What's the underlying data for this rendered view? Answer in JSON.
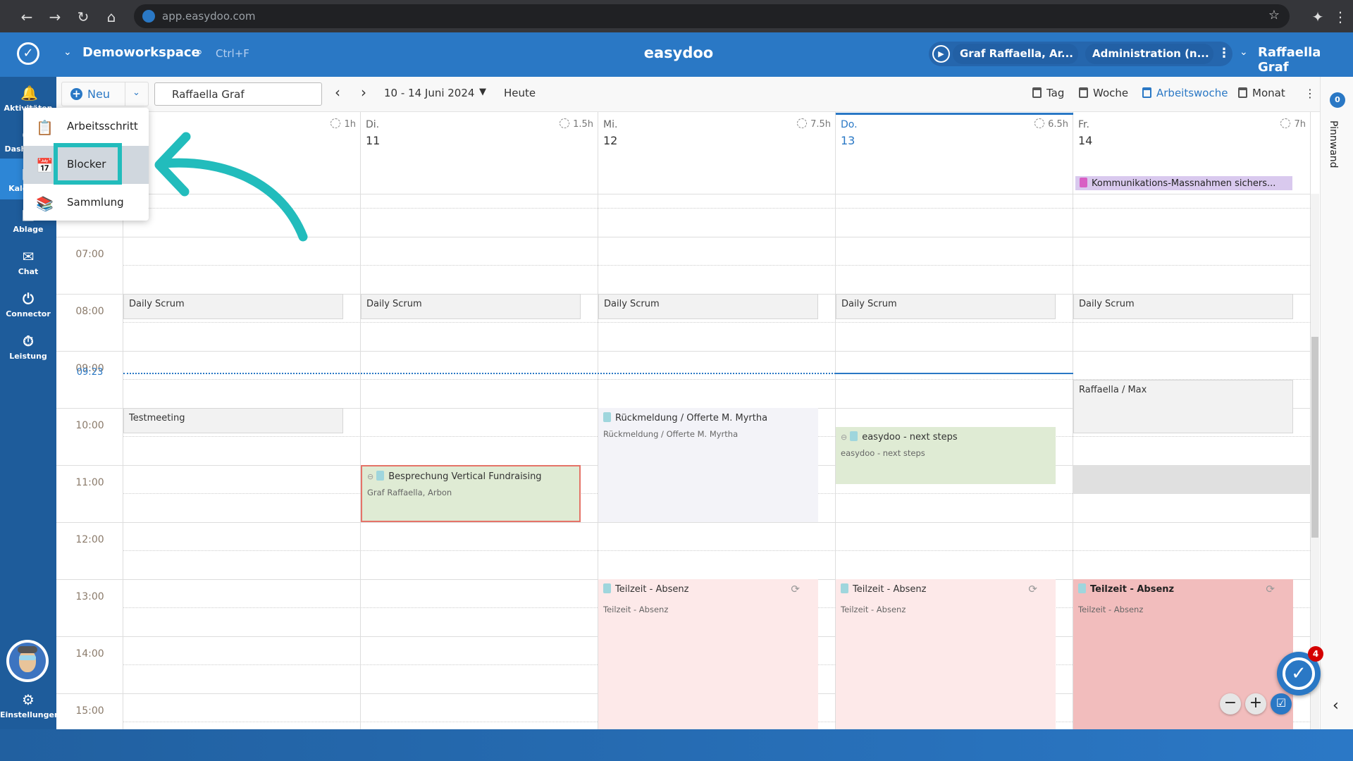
{
  "browser": {
    "url": "app.easydoo.com"
  },
  "header": {
    "workspace": "Demoworkspace",
    "search_hint": "Ctrl+F",
    "app_title": "easydoo",
    "timer_task": "Graf Raffaella, Ar...",
    "timer_activity": "Administration (n...",
    "user": "Raffaella Graf"
  },
  "sidebar": {
    "items": [
      {
        "label": "Aktivitäten",
        "icon": "bell-icon"
      },
      {
        "label": "Dashboard",
        "icon": "dashboard-icon"
      },
      {
        "label": "Kalender",
        "icon": "calendar-icon",
        "active": true
      },
      {
        "label": "Ablage",
        "icon": "folder-icon"
      },
      {
        "label": "Chat",
        "icon": "chat-icon"
      },
      {
        "label": "Connector",
        "icon": "plug-icon"
      },
      {
        "label": "Leistung",
        "icon": "stopwatch-icon"
      }
    ],
    "settings": "Einstellungen"
  },
  "toolbar": {
    "new_label": "Neu",
    "person": "Raffaella Graf",
    "date_range": "10 - 14 Juni 2024",
    "today": "Heute",
    "views": [
      "Tag",
      "Woche",
      "Arbeitswoche",
      "Monat"
    ],
    "active_view": "Arbeitswoche"
  },
  "menu": {
    "items": [
      "Arbeitsschritt",
      "Blocker",
      "Sammlung"
    ],
    "highlighted": "Blocker"
  },
  "calendar": {
    "now": "09:23",
    "hours": [
      "07:00",
      "08:00",
      "09:00",
      "10:00",
      "11:00",
      "12:00",
      "13:00",
      "14:00",
      "15:00"
    ],
    "days": [
      {
        "name": "",
        "date": "",
        "duration": "1h"
      },
      {
        "name": "Di.",
        "date": "11",
        "duration": "1.5h"
      },
      {
        "name": "Mi.",
        "date": "12",
        "duration": "7.5h"
      },
      {
        "name": "Do.",
        "date": "13",
        "duration": "6.5h",
        "today": true
      },
      {
        "name": "Fr.",
        "date": "14",
        "duration": "7h"
      }
    ],
    "allday": [
      {
        "day": 4,
        "title": "Kommunikations-Massnahmen sichers..."
      }
    ],
    "events": [
      {
        "day": 0,
        "start": "08:00",
        "end": "08:27",
        "title": "Daily Scrum",
        "style": "meeting"
      },
      {
        "day": 1,
        "start": "08:00",
        "end": "08:27",
        "title": "Daily Scrum",
        "style": "meeting"
      },
      {
        "day": 2,
        "start": "08:00",
        "end": "08:27",
        "title": "Daily Scrum",
        "style": "meeting"
      },
      {
        "day": 3,
        "start": "08:00",
        "end": "08:27",
        "title": "Daily Scrum",
        "style": "meeting"
      },
      {
        "day": 4,
        "start": "08:00",
        "end": "08:27",
        "title": "Daily Scrum",
        "style": "meeting"
      },
      {
        "day": 0,
        "start": "10:00",
        "end": "10:27",
        "title": "Testmeeting",
        "style": "meeting"
      },
      {
        "day": 4,
        "start": "09:30",
        "end": "10:27",
        "title": "Raffaella / Max",
        "style": "meeting"
      },
      {
        "day": 2,
        "start": "10:00",
        "end": "12:00",
        "title": "Rückmeldung / Offerte M. Myrtha",
        "subtitle": "Rückmeldung / Offerte M. Myrtha",
        "style": "lilac",
        "task_icon": true
      },
      {
        "day": 3,
        "start": "10:20",
        "end": "11:20",
        "title": "easydoo - next steps",
        "subtitle": "easydoo - next steps",
        "style": "green",
        "link_icon": true,
        "task_icon": true
      },
      {
        "day": 1,
        "start": "11:00",
        "end": "12:00",
        "title": "Besprechung Vertical Fundraising",
        "subtitle": "Graf Raffaella, Arbon",
        "style": "green-red",
        "link_icon": true,
        "task_icon": true
      },
      {
        "day": 4,
        "start": "11:00",
        "end": "11:30",
        "title": "",
        "style": "block",
        "full": true
      },
      {
        "day": 2,
        "start": "13:00",
        "end": "17:00",
        "title": "Teilzeit - Absenz",
        "subtitle": "Teilzeit - Absenz",
        "style": "absence",
        "task_icon": true,
        "recurring": true
      },
      {
        "day": 3,
        "start": "13:00",
        "end": "17:00",
        "title": "Teilzeit - Absenz",
        "subtitle": "Teilzeit - Absenz",
        "style": "absence",
        "task_icon": true,
        "recurring": true
      },
      {
        "day": 4,
        "start": "13:00",
        "end": "17:00",
        "title": "Teilzeit - Absenz",
        "subtitle": "Teilzeit - Absenz",
        "style": "absence-strong",
        "task_icon": true,
        "recurring": true
      }
    ]
  },
  "pinboard": {
    "label": "Pinnwand",
    "count": "0"
  },
  "fab": {
    "badge": "4"
  },
  "colors": {
    "brand": "#2a78c5",
    "sidebar": "#1e5c9b",
    "highlight": "#22bcbc",
    "now_line": "#2a78c5"
  }
}
